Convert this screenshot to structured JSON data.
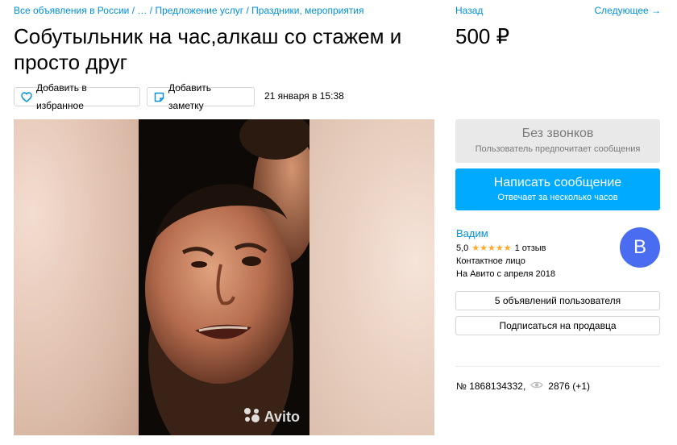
{
  "breadcrumbs": {
    "items": [
      "Все объявления в России",
      "…",
      "Предложение услуг",
      "Праздники, мероприятия"
    ],
    "separator": "/"
  },
  "listing": {
    "title": "Собутыльник на час,алкаш со стажем и просто друг",
    "price": "500 ₽",
    "date": "21 января в 15:38",
    "number": "№ 1868134332,",
    "views": "2876 (+1)"
  },
  "actions": {
    "favorite_label": "Добавить в избранное",
    "note_label": "Добавить заметку"
  },
  "nav": {
    "back_label": "Назад",
    "next_label": "Следующее →"
  },
  "gallery": {
    "watermark": "Avito"
  },
  "contact": {
    "no_calls_title": "Без звонков",
    "no_calls_subtitle": "Пользователь предпочитает сообщения",
    "message_button": "Написать сообщение",
    "message_subtitle": "Отвечает за несколько часов"
  },
  "seller": {
    "name": "Вадим",
    "rating": "5,0",
    "stars": "★★★★★",
    "reviews": "1 отзыв",
    "type": "Контактное лицо",
    "since": "На Авито с апреля 2018",
    "avatar_letter": "В",
    "ads_button": "5 объявлений пользователя",
    "subscribe_button": "Подписаться на продавца"
  },
  "colors": {
    "link": "#0091d9",
    "primary_button": "#00aaff",
    "avatar": "#4a6cf0",
    "stars": "#ffa92b"
  }
}
